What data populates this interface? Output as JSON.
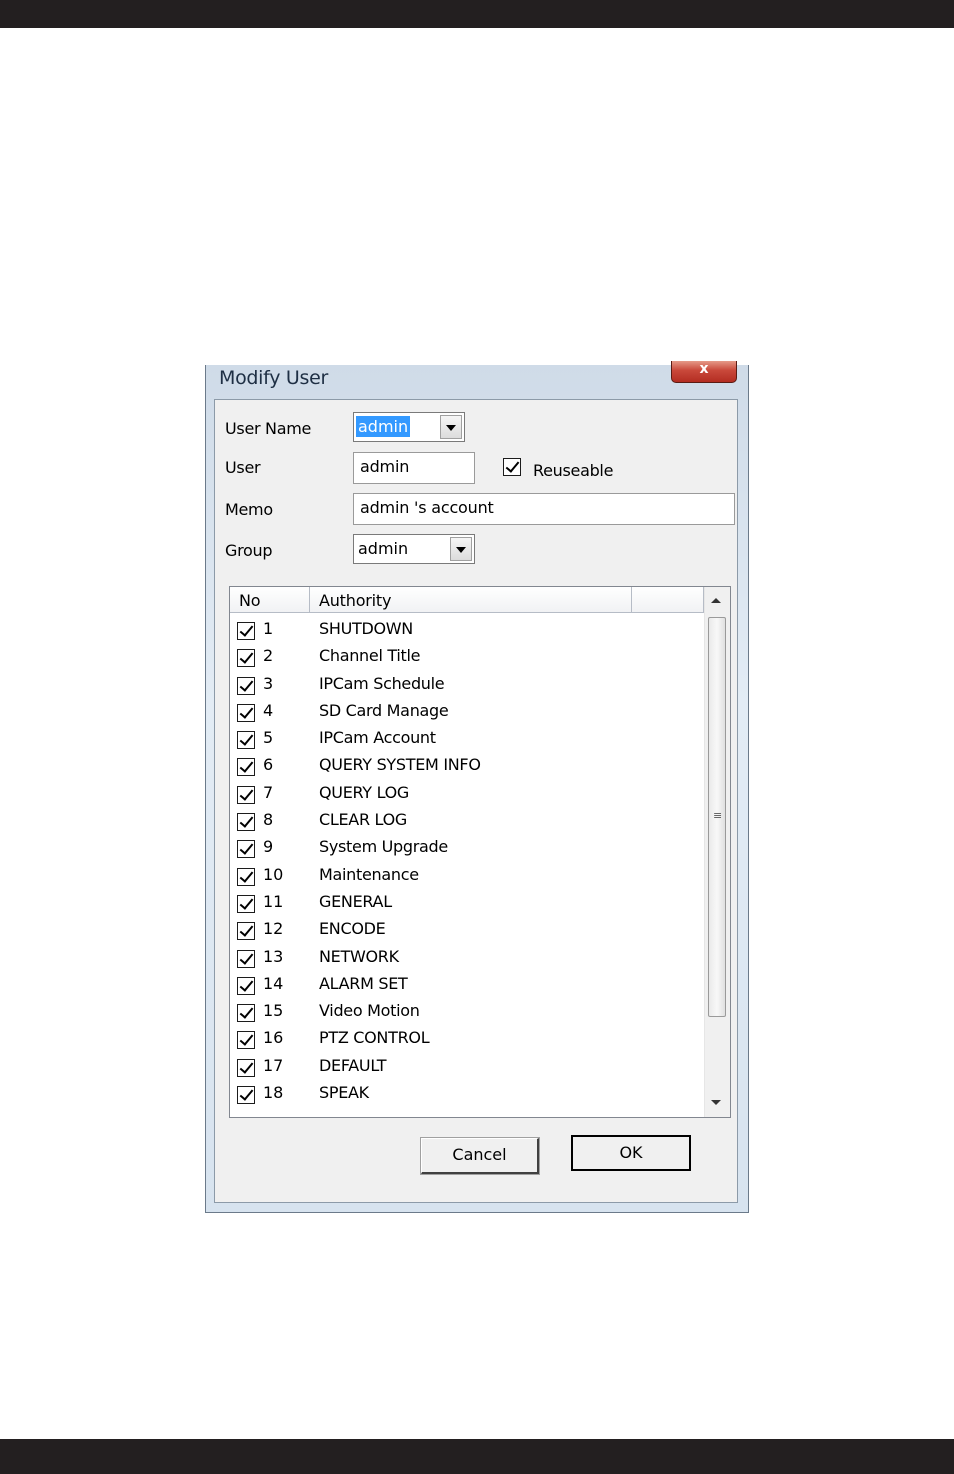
{
  "dialog": {
    "title": "Modify User",
    "close_label": "x"
  },
  "form": {
    "user_name_label": "User Name",
    "user_name_value": "admin",
    "user_label": "User",
    "user_value": "admin",
    "reuseable_label": "Reuseable",
    "reuseable_checked": true,
    "memo_label": "Memo",
    "memo_value": "admin 's account",
    "group_label": "Group",
    "group_value": "admin"
  },
  "list": {
    "columns": [
      "No",
      "Authority",
      ""
    ],
    "rows": [
      {
        "no": "1",
        "authority": "SHUTDOWN",
        "checked": true
      },
      {
        "no": "2",
        "authority": "Channel Title",
        "checked": true
      },
      {
        "no": "3",
        "authority": "IPCam Schedule",
        "checked": true
      },
      {
        "no": "4",
        "authority": "SD Card Manage",
        "checked": true
      },
      {
        "no": "5",
        "authority": "IPCam Account",
        "checked": true
      },
      {
        "no": "6",
        "authority": "QUERY SYSTEM INFO",
        "checked": true
      },
      {
        "no": "7",
        "authority": "QUERY LOG",
        "checked": true
      },
      {
        "no": "8",
        "authority": "CLEAR LOG",
        "checked": true
      },
      {
        "no": "9",
        "authority": "System Upgrade",
        "checked": true
      },
      {
        "no": "10",
        "authority": "Maintenance",
        "checked": true
      },
      {
        "no": "11",
        "authority": "GENERAL",
        "checked": true
      },
      {
        "no": "12",
        "authority": "ENCODE",
        "checked": true
      },
      {
        "no": "13",
        "authority": "NETWORK",
        "checked": true
      },
      {
        "no": "14",
        "authority": "ALARM SET",
        "checked": true
      },
      {
        "no": "15",
        "authority": "Video Motion",
        "checked": true
      },
      {
        "no": "16",
        "authority": "PTZ CONTROL",
        "checked": true
      },
      {
        "no": "17",
        "authority": "DEFAULT",
        "checked": true
      },
      {
        "no": "18",
        "authority": "SPEAK",
        "checked": true
      }
    ]
  },
  "buttons": {
    "cancel": "Cancel",
    "ok": "OK"
  }
}
